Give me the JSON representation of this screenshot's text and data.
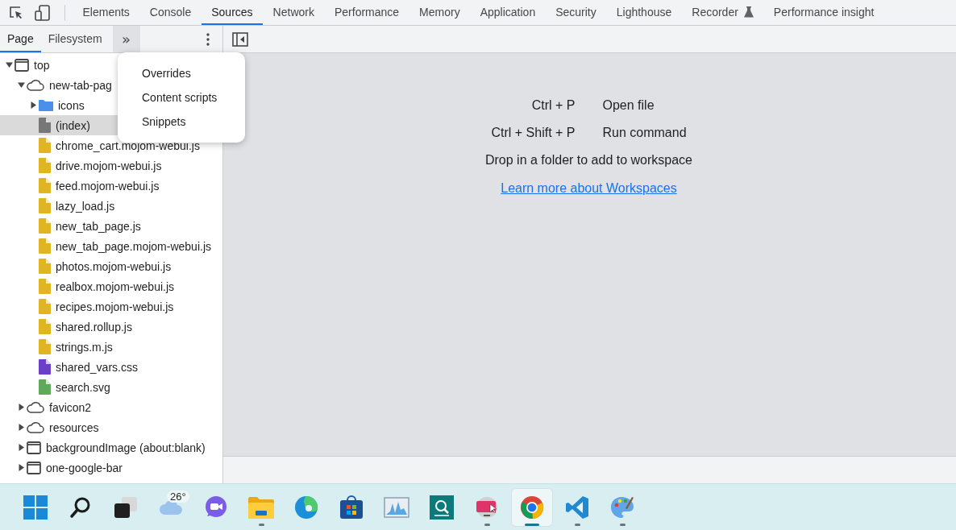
{
  "main_tabs": [
    {
      "label": "Elements",
      "selected": false
    },
    {
      "label": "Console",
      "selected": false
    },
    {
      "label": "Sources",
      "selected": true
    },
    {
      "label": "Network",
      "selected": false
    },
    {
      "label": "Performance",
      "selected": false
    },
    {
      "label": "Memory",
      "selected": false
    },
    {
      "label": "Application",
      "selected": false
    },
    {
      "label": "Security",
      "selected": false
    },
    {
      "label": "Lighthouse",
      "selected": false
    },
    {
      "label": "Recorder",
      "selected": false,
      "experimental": true
    },
    {
      "label": "Performance insight",
      "selected": false
    }
  ],
  "navigator_tabs": [
    {
      "label": "Page",
      "selected": true
    },
    {
      "label": "Filesystem",
      "selected": false
    }
  ],
  "more_tabs_button": {
    "label": "»",
    "open": true
  },
  "more_tabs_menu": [
    "Overrides",
    "Content scripts",
    "Snippets"
  ],
  "tree": [
    {
      "label": "top",
      "kind": "frame",
      "expanded": true,
      "selected": false,
      "children": [
        {
          "label": "new-tab-pag",
          "kind": "domain",
          "expanded": true,
          "selected": false,
          "children": [
            {
              "label": "icons",
              "kind": "folder",
              "expanded": false,
              "selected": false
            },
            {
              "label": "(index)",
              "kind": "document",
              "selected": true
            },
            {
              "label": "chrome_cart.mojom-webui.js",
              "kind": "script",
              "selected": false
            },
            {
              "label": "drive.mojom-webui.js",
              "kind": "script",
              "selected": false
            },
            {
              "label": "feed.mojom-webui.js",
              "kind": "script",
              "selected": false
            },
            {
              "label": "lazy_load.js",
              "kind": "script",
              "selected": false
            },
            {
              "label": "new_tab_page.js",
              "kind": "script",
              "selected": false
            },
            {
              "label": "new_tab_page.mojom-webui.js",
              "kind": "script",
              "selected": false
            },
            {
              "label": "photos.mojom-webui.js",
              "kind": "script",
              "selected": false
            },
            {
              "label": "realbox.mojom-webui.js",
              "kind": "script",
              "selected": false
            },
            {
              "label": "recipes.mojom-webui.js",
              "kind": "script",
              "selected": false
            },
            {
              "label": "shared.rollup.js",
              "kind": "script",
              "selected": false
            },
            {
              "label": "strings.m.js",
              "kind": "script",
              "selected": false
            },
            {
              "label": "shared_vars.css",
              "kind": "stylesheet",
              "selected": false
            },
            {
              "label": "search.svg",
              "kind": "image",
              "selected": false
            }
          ]
        },
        {
          "label": "favicon2",
          "kind": "domain",
          "expanded": false,
          "selected": false
        },
        {
          "label": "resources",
          "kind": "domain",
          "expanded": false,
          "selected": false
        },
        {
          "label": "backgroundImage (about:blank)",
          "kind": "frame",
          "expanded": false,
          "selected": false
        },
        {
          "label": "one-google-bar",
          "kind": "frame",
          "expanded": false,
          "selected": false
        }
      ]
    }
  ],
  "shortcuts": [
    {
      "keys": "Ctrl + P",
      "action": "Open file"
    },
    {
      "keys": "Ctrl + Shift + P",
      "action": "Run command"
    }
  ],
  "drop_hint": "Drop in a folder to add to workspace",
  "learn_more_link": "Learn more about Workspaces",
  "taskbar": [
    {
      "kind": "start",
      "running": false,
      "selected": false
    },
    {
      "kind": "search",
      "running": false,
      "selected": false
    },
    {
      "kind": "task-view",
      "running": false,
      "selected": false
    },
    {
      "kind": "weather",
      "badge": "26°",
      "running": false,
      "selected": false
    },
    {
      "kind": "chat",
      "running": false,
      "selected": false
    },
    {
      "kind": "explorer",
      "running": true,
      "selected": false
    },
    {
      "kind": "edge",
      "running": false,
      "selected": false
    },
    {
      "kind": "store",
      "running": false,
      "selected": false
    },
    {
      "kind": "monitor",
      "running": false,
      "selected": false
    },
    {
      "kind": "remote",
      "running": false,
      "selected": false
    },
    {
      "kind": "screen",
      "running": true,
      "selected": false
    },
    {
      "kind": "chrome",
      "running": true,
      "selected": true
    },
    {
      "kind": "vscode",
      "running": true,
      "selected": false
    },
    {
      "kind": "paint",
      "running": true,
      "selected": false
    }
  ]
}
